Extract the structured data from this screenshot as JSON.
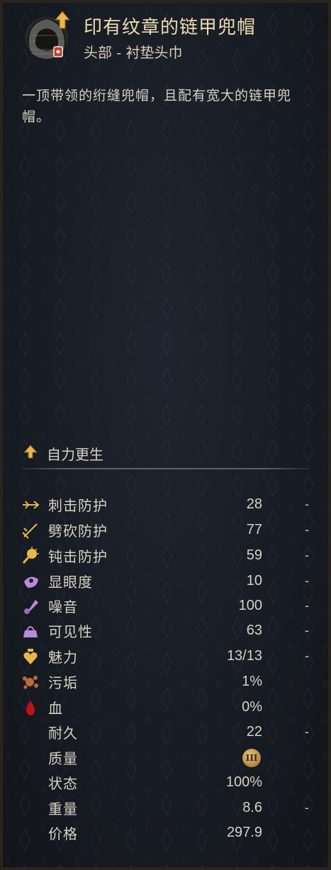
{
  "item": {
    "name": "印有纹章的链甲兜帽",
    "slot": "头部 - 衬垫头巾",
    "description": "一顶带领的绗缝兜帽，且配有宽大的链甲兜帽。",
    "icon": "chainmail-coif-icon"
  },
  "upgrade": {
    "label": "自力更生",
    "icon": "up-arrow-icon"
  },
  "stats": [
    {
      "label": "刺击防护",
      "value": "28",
      "compare": "-",
      "icon": "stab-protection-icon"
    },
    {
      "label": "劈砍防护",
      "value": "77",
      "compare": "-",
      "icon": "slash-protection-icon"
    },
    {
      "label": "钝击防护",
      "value": "59",
      "compare": "-",
      "icon": "blunt-protection-icon"
    },
    {
      "label": "显眼度",
      "value": "10",
      "compare": "-",
      "icon": "conspicuousness-icon"
    },
    {
      "label": "噪音",
      "value": "100",
      "compare": "-",
      "icon": "noise-icon"
    },
    {
      "label": "可见性",
      "value": "63",
      "compare": "-",
      "icon": "visibility-icon"
    },
    {
      "label": "魅力",
      "value": "13/13",
      "compare": "-",
      "icon": "charisma-icon"
    },
    {
      "label": "污垢",
      "value": "1%",
      "compare": "",
      "icon": "dirt-icon"
    },
    {
      "label": "血",
      "value": "0%",
      "compare": "",
      "icon": "blood-icon"
    },
    {
      "label": "耐久",
      "value": "22",
      "compare": "-",
      "icon": ""
    },
    {
      "label": "质量",
      "value": "",
      "compare": "",
      "icon": "",
      "badge": "III"
    },
    {
      "label": "状态",
      "value": "100%",
      "compare": "",
      "icon": ""
    },
    {
      "label": "重量",
      "value": "8.6",
      "compare": "-",
      "icon": ""
    },
    {
      "label": "价格",
      "value": "297.9",
      "compare": "",
      "icon": ""
    }
  ],
  "colors": {
    "title": "#ecdcb0",
    "text": "#d8d2c4",
    "blood": "#c0101a",
    "badge": "#c8964a",
    "accent_gold": "#e8b84a"
  }
}
